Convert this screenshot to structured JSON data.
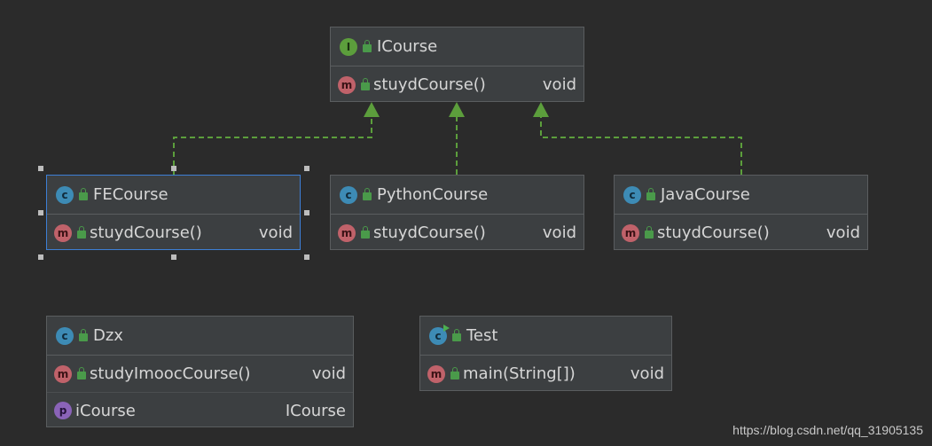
{
  "nodes": {
    "icourse": {
      "badge": "I",
      "title": "ICourse",
      "members": [
        {
          "badge": "m",
          "name": "stuydCourse()",
          "type": "void"
        }
      ]
    },
    "fecourse": {
      "badge": "c",
      "title": "FECourse",
      "members": [
        {
          "badge": "m",
          "name": "stuydCourse()",
          "type": "void"
        }
      ]
    },
    "pythoncourse": {
      "badge": "c",
      "title": "PythonCourse",
      "members": [
        {
          "badge": "m",
          "name": "stuydCourse()",
          "type": "void"
        }
      ]
    },
    "javacourse": {
      "badge": "c",
      "title": "JavaCourse",
      "members": [
        {
          "badge": "m",
          "name": "stuydCourse()",
          "type": "void"
        }
      ]
    },
    "dzx": {
      "badge": "c",
      "title": "Dzx",
      "members": [
        {
          "badge": "m",
          "name": "studyImoocCourse()",
          "type": "void"
        },
        {
          "badge": "p",
          "name": "iCourse",
          "type": "ICourse"
        }
      ]
    },
    "test": {
      "badge": "c",
      "title": "Test",
      "members": [
        {
          "badge": "m",
          "name": "main(String[])",
          "type": "void"
        }
      ]
    }
  },
  "relations": [
    {
      "from": "FECourse",
      "to": "ICourse",
      "kind": "implements"
    },
    {
      "from": "PythonCourse",
      "to": "ICourse",
      "kind": "implements"
    },
    {
      "from": "JavaCourse",
      "to": "ICourse",
      "kind": "implements"
    }
  ],
  "colors": {
    "background": "#2b2b2b",
    "node_fill": "#3c3f41",
    "selection": "#3d7fd6",
    "realization_edge": "#5c9e3c"
  },
  "watermark": "https://blog.csdn.net/qq_31905135"
}
